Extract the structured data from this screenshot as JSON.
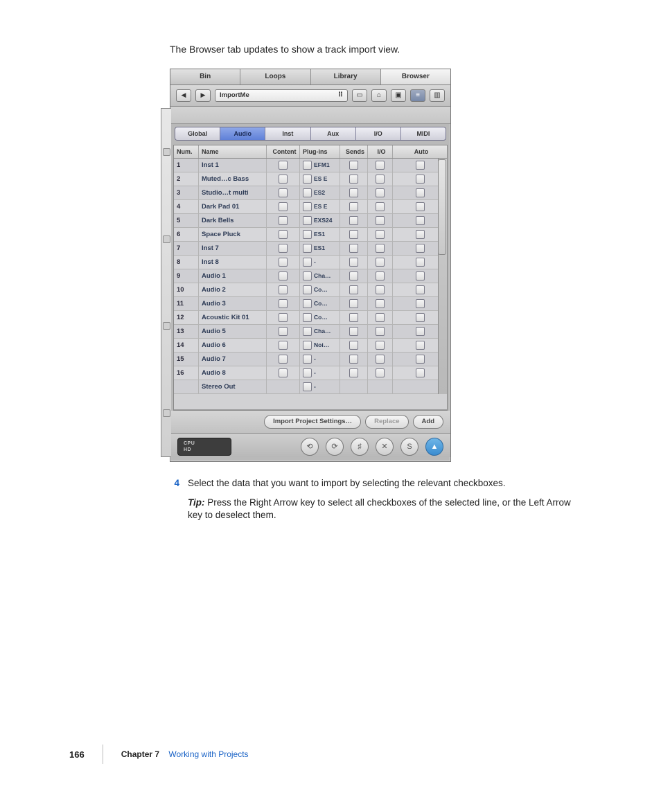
{
  "intro_text": "The Browser tab updates to show a track import view.",
  "step_number": "4",
  "step_text": "Select the data that you want to import by selecting the relevant checkboxes.",
  "tip_label": "Tip:",
  "tip_text": "  Press the Right Arrow key to select all checkboxes of the selected line, or the Left Arrow key to deselect them.",
  "footer": {
    "page": "166",
    "chapter_label": "Chapter 7",
    "chapter_title": "Working with Projects"
  },
  "shot": {
    "top_tabs": [
      "Bin",
      "Loops",
      "Library",
      "Browser"
    ],
    "active_top_tab": 3,
    "path_field": "ImportMe",
    "filter_tabs": [
      "Global",
      "Audio",
      "Inst",
      "Aux",
      "I/O",
      "MIDI"
    ],
    "filter_selected": 1,
    "columns": [
      "Num.",
      "Name",
      "Content",
      "Plug-ins",
      "Sends",
      "I/O",
      "Auto"
    ],
    "rows": [
      {
        "num": "1",
        "name": "Inst 1",
        "plugin": "EFM1",
        "content": true,
        "sends": true,
        "io": true,
        "auto": true
      },
      {
        "num": "2",
        "name": "Muted…c Bass",
        "plugin": "ES E",
        "content": true,
        "sends": true,
        "io": true,
        "auto": true
      },
      {
        "num": "3",
        "name": "Studio…t multi",
        "plugin": "ES2",
        "content": true,
        "sends": true,
        "io": true,
        "auto": true
      },
      {
        "num": "4",
        "name": "Dark Pad 01",
        "plugin": "ES E",
        "content": true,
        "sends": true,
        "io": true,
        "auto": true
      },
      {
        "num": "5",
        "name": "Dark Bells",
        "plugin": "EXS24",
        "content": true,
        "sends": true,
        "io": true,
        "auto": true
      },
      {
        "num": "6",
        "name": "Space Pluck",
        "plugin": "ES1",
        "content": true,
        "sends": true,
        "io": true,
        "auto": true
      },
      {
        "num": "7",
        "name": "Inst 7",
        "plugin": "ES1",
        "content": true,
        "sends": true,
        "io": true,
        "auto": true
      },
      {
        "num": "8",
        "name": "Inst 8",
        "plugin": "-",
        "content": true,
        "sends": true,
        "io": true,
        "auto": true
      },
      {
        "num": "9",
        "name": "Audio 1",
        "plugin": "Cha…",
        "content": true,
        "sends": true,
        "io": true,
        "auto": true
      },
      {
        "num": "10",
        "name": "Audio 2",
        "plugin": "Co…",
        "content": true,
        "sends": true,
        "io": true,
        "auto": true
      },
      {
        "num": "11",
        "name": "Audio 3",
        "plugin": "Co…",
        "content": true,
        "sends": true,
        "io": true,
        "auto": true
      },
      {
        "num": "12",
        "name": "Acoustic Kit 01",
        "plugin": "Co…",
        "content": true,
        "sends": true,
        "io": true,
        "auto": true
      },
      {
        "num": "13",
        "name": "Audio 5",
        "plugin": "Cha…",
        "content": true,
        "sends": true,
        "io": true,
        "auto": true
      },
      {
        "num": "14",
        "name": "Audio 6",
        "plugin": "Noi…",
        "content": true,
        "sends": true,
        "io": true,
        "auto": true
      },
      {
        "num": "15",
        "name": "Audio 7",
        "plugin": "-",
        "content": true,
        "sends": true,
        "io": true,
        "auto": true
      },
      {
        "num": "16",
        "name": "Audio 8",
        "plugin": "-",
        "content": true,
        "sends": true,
        "io": true,
        "auto": true
      },
      {
        "num": "",
        "name": "Stereo Out",
        "plugin": "-",
        "content": false,
        "sends": false,
        "io": false,
        "auto": false
      }
    ],
    "actions": {
      "import": "Import Project Settings…",
      "replace": "Replace",
      "add": "Add"
    },
    "status": {
      "cpu": "CPU",
      "hd": "HD"
    }
  }
}
